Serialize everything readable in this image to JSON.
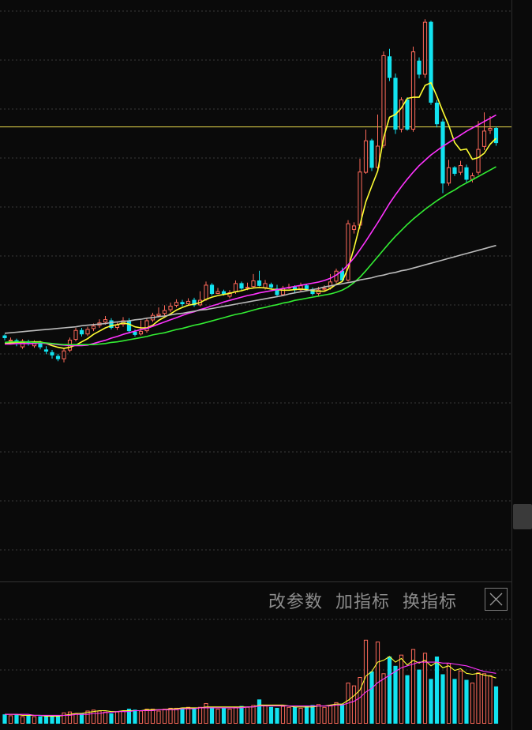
{
  "toolbar": {
    "modify_params": "改参数",
    "add_indicator": "加指标",
    "switch_indicator": "换指标"
  },
  "colors": {
    "background": "#0a0a0a",
    "up_candle": "#ff6a5a",
    "down_candle": "#12e3f0",
    "ma5": "#ffff33",
    "ma10": "#ff33ff",
    "ma20": "#33ee33",
    "ma60": "#bbbbbb",
    "reference_line": "#e6d94a",
    "grid": "#3a3a3a"
  },
  "icons": {
    "close": "close-x-icon"
  },
  "chart_data": [
    {
      "type": "candlestick",
      "name": "price",
      "ylim": [
        0,
        100
      ],
      "reference_level": 78.5,
      "candles": [
        [
          39.8,
          39.3,
          40.0,
          38.9
        ],
        [
          38.7,
          39.0,
          39.4,
          38.2
        ],
        [
          38.9,
          38.2,
          39.2,
          37.8
        ],
        [
          37.6,
          38.8,
          39.1,
          37.3
        ],
        [
          38.7,
          38.2,
          39.0,
          37.9
        ],
        [
          37.8,
          38.5,
          38.9,
          37.5
        ],
        [
          38.5,
          37.6,
          38.8,
          37.2
        ],
        [
          37.2,
          36.8,
          37.8,
          36.3
        ],
        [
          36.7,
          36.1,
          37.1,
          35.5
        ],
        [
          36.0,
          35.4,
          36.4,
          35.0
        ],
        [
          35.4,
          37.0,
          37.4,
          34.8
        ],
        [
          37.0,
          39.0,
          39.4,
          36.7
        ],
        [
          39.0,
          40.8,
          41.2,
          38.7
        ],
        [
          40.8,
          40.0,
          41.2,
          39.6
        ],
        [
          40.0,
          41.0,
          41.4,
          39.7
        ],
        [
          41.0,
          41.6,
          42.0,
          40.6
        ],
        [
          41.6,
          42.2,
          42.8,
          41.2
        ],
        [
          42.2,
          42.8,
          43.4,
          41.8
        ],
        [
          42.6,
          41.2,
          43.0,
          40.9
        ],
        [
          41.2,
          41.8,
          42.2,
          40.8
        ],
        [
          41.8,
          42.6,
          43.2,
          41.4
        ],
        [
          42.6,
          40.6,
          43.0,
          40.2
        ],
        [
          40.5,
          39.9,
          40.9,
          39.6
        ],
        [
          40.0,
          40.6,
          42.6,
          39.8
        ],
        [
          40.6,
          42.6,
          43.0,
          40.3
        ],
        [
          42.6,
          43.6,
          44.0,
          42.3
        ],
        [
          43.4,
          43.8,
          45.0,
          43.1
        ],
        [
          43.8,
          44.5,
          45.4,
          43.5
        ],
        [
          44.5,
          45.3,
          45.9,
          44.1
        ],
        [
          45.3,
          46.0,
          46.5,
          45.0
        ],
        [
          46.0,
          45.6,
          46.4,
          45.2
        ],
        [
          45.6,
          46.2,
          46.7,
          45.3
        ],
        [
          46.4,
          45.4,
          46.8,
          45.1
        ],
        [
          45.4,
          46.4,
          48.0,
          45.2
        ],
        [
          46.4,
          49.2,
          49.8,
          46.2
        ],
        [
          49.2,
          47.5,
          49.5,
          47.2
        ],
        [
          47.5,
          48.0,
          48.6,
          47.6
        ],
        [
          48.0,
          47.5,
          48.3,
          47.2
        ],
        [
          47.0,
          47.8,
          48.2,
          46.7
        ],
        [
          47.8,
          49.5,
          50.0,
          47.5
        ],
        [
          49.5,
          48.5,
          49.8,
          48.2
        ],
        [
          48.5,
          48.8,
          49.6,
          48.2
        ],
        [
          48.8,
          50.0,
          51.2,
          48.5
        ],
        [
          50.0,
          49.0,
          51.8,
          48.9
        ],
        [
          48.6,
          49.5,
          50.1,
          48.3
        ],
        [
          49.3,
          48.7,
          49.6,
          48.4
        ],
        [
          48.5,
          47.3,
          49.2,
          46.9
        ],
        [
          47.3,
          48.6,
          49.0,
          47.1
        ],
        [
          48.6,
          48.8,
          49.4,
          48.4
        ],
        [
          48.8,
          48.2,
          49.1,
          47.8
        ],
        [
          48.2,
          49.1,
          49.6,
          47.9
        ],
        [
          49.1,
          48.4,
          49.4,
          48.1
        ],
        [
          48.4,
          47.5,
          48.7,
          47.2
        ],
        [
          47.5,
          48.3,
          48.8,
          47.2
        ],
        [
          48.3,
          48.6,
          49.1,
          48.0
        ],
        [
          48.6,
          49.8,
          51.2,
          48.3
        ],
        [
          49.8,
          51.8,
          52.2,
          49.5
        ],
        [
          51.8,
          50.0,
          52.4,
          49.7
        ],
        [
          50.0,
          60.6,
          61.2,
          49.8
        ],
        [
          59.4,
          60.2,
          60.8,
          58.7
        ],
        [
          60.2,
          70.2,
          72.6,
          59.6
        ],
        [
          70.0,
          76.0,
          78.0,
          69.8
        ],
        [
          76.0,
          70.9,
          76.3,
          70.3
        ],
        [
          70.9,
          75.0,
          80.8,
          70.5
        ],
        [
          75.0,
          91.8,
          92.5,
          74.6
        ],
        [
          91.6,
          87.6,
          93.0,
          87.0
        ],
        [
          87.6,
          78.0,
          88.4,
          77.2
        ],
        [
          78.0,
          83.6,
          84.0,
          77.5
        ],
        [
          83.6,
          78.0,
          84.0,
          77.8
        ],
        [
          78.0,
          92.5,
          93.4,
          77.6
        ],
        [
          90.8,
          88.2,
          91.4,
          87.5
        ],
        [
          88.2,
          98.0,
          98.5,
          87.6
        ],
        [
          98.0,
          83.0,
          98.2,
          82.6
        ],
        [
          83.0,
          79.0,
          83.5,
          78.4
        ],
        [
          79.5,
          68.0,
          80.0,
          66.2
        ],
        [
          68.0,
          71.0,
          72.4,
          67.6
        ],
        [
          71.0,
          69.8,
          71.2,
          69.4
        ],
        [
          70.0,
          71.4,
          72.2,
          69.6
        ],
        [
          71.0,
          68.7,
          71.5,
          68.2
        ],
        [
          68.7,
          69.5,
          70.0,
          68.2
        ],
        [
          70.0,
          74.4,
          79.6,
          69.6
        ],
        [
          74.8,
          77.8,
          81.2,
          74.2
        ],
        [
          77.8,
          78.3,
          80.5,
          77.2
        ],
        [
          78.3,
          75.5,
          78.6,
          75.0
        ]
      ],
      "ma_lines": [
        {
          "period": 5,
          "values": [
            38.3,
            38.4,
            38.5,
            38.5,
            38.6,
            38.6,
            38.6,
            38.3,
            37.9,
            37.6,
            37.4,
            37.6,
            38.0,
            38.6,
            39.2,
            40.0,
            40.6,
            41.2,
            41.6,
            41.8,
            42.1,
            41.9,
            41.4,
            41.2,
            41.2,
            41.7,
            42.6,
            43.2,
            43.8,
            44.5,
            45.0,
            45.4,
            45.6,
            45.9,
            46.5,
            46.9,
            47.2,
            47.4,
            47.6,
            47.9,
            48.1,
            48.4,
            48.6,
            48.7,
            48.6,
            48.4,
            48.3,
            48.2,
            48.2,
            48.3,
            48.4,
            48.3,
            48.1,
            48.0,
            48.0,
            48.5,
            49.3,
            49.8,
            52.3,
            56.0,
            60.3,
            64.6,
            67.5,
            70.3,
            76.5,
            80.3,
            80.8,
            82.0,
            83.8,
            84.0,
            84.0,
            86.2,
            86.7,
            84.2,
            81.4,
            78.8,
            75.6,
            74.2,
            74.4,
            72.5,
            72.8,
            73.6,
            75.3,
            76.4
          ]
        },
        {
          "period": 10,
          "values": [
            38.2,
            38.2,
            38.3,
            38.3,
            38.3,
            38.3,
            38.4,
            38.3,
            38.2,
            38.1,
            38.0,
            37.9,
            37.9,
            37.9,
            38.0,
            38.3,
            38.6,
            38.9,
            39.3,
            39.6,
            40.0,
            40.3,
            40.6,
            40.9,
            41.1,
            41.5,
            41.9,
            42.3,
            42.7,
            43.1,
            43.5,
            43.9,
            44.2,
            44.6,
            44.9,
            45.3,
            45.6,
            46.0,
            46.3,
            46.6,
            46.9,
            47.2,
            47.4,
            47.7,
            47.9,
            48.1,
            48.3,
            48.5,
            48.7,
            48.9,
            49.1,
            49.3,
            49.5,
            49.7,
            50.0,
            50.4,
            51.0,
            51.8,
            52.9,
            54.2,
            55.7,
            57.3,
            59.0,
            60.7,
            62.5,
            64.3,
            65.9,
            67.4,
            68.8,
            70.1,
            71.3,
            72.3,
            73.3,
            74.1,
            74.9,
            75.6,
            76.3,
            77.0,
            77.7,
            78.3,
            78.9,
            79.5,
            80.1,
            80.7
          ]
        },
        {
          "period": 20,
          "values": [
            38.5,
            38.6,
            38.6,
            38.6,
            38.6,
            38.5,
            38.5,
            38.4,
            38.3,
            38.2,
            38.1,
            38.1,
            38.1,
            38.1,
            38.1,
            38.1,
            38.2,
            38.3,
            38.5,
            38.6,
            38.8,
            39.0,
            39.2,
            39.4,
            39.6,
            39.9,
            40.1,
            40.3,
            40.6,
            40.9,
            41.1,
            41.4,
            41.7,
            41.9,
            42.2,
            42.5,
            42.8,
            43.1,
            43.4,
            43.7,
            43.9,
            44.2,
            44.5,
            44.8,
            45.0,
            45.3,
            45.5,
            45.8,
            46.0,
            46.3,
            46.5,
            46.7,
            46.9,
            47.1,
            47.3,
            47.5,
            47.8,
            48.2,
            48.8,
            49.6,
            50.6,
            51.8,
            53.1,
            54.4,
            55.7,
            57.0,
            58.2,
            59.3,
            60.4,
            61.4,
            62.3,
            63.2,
            64.0,
            64.8,
            65.5,
            66.2,
            66.8,
            67.5,
            68.1,
            68.7,
            69.3,
            69.9,
            70.5,
            71.1
          ]
        },
        {
          "period": 60,
          "values": [
            40.2,
            40.3,
            40.4,
            40.5,
            40.6,
            40.7,
            40.8,
            40.9,
            41.0,
            41.1,
            41.2,
            41.3,
            41.4,
            41.6,
            41.7,
            41.8,
            41.9,
            42.0,
            42.2,
            42.3,
            42.4,
            42.5,
            42.7,
            42.8,
            43.0,
            43.1,
            43.3,
            43.4,
            43.6,
            43.8,
            43.9,
            44.1,
            44.3,
            44.5,
            44.6,
            44.8,
            45.0,
            45.2,
            45.4,
            45.6,
            45.8,
            46.0,
            46.2,
            46.4,
            46.6,
            46.8,
            47.0,
            47.2,
            47.5,
            47.7,
            47.9,
            48.1,
            48.3,
            48.5,
            48.8,
            49.0,
            49.2,
            49.4,
            49.6,
            49.8,
            50.1,
            50.3,
            50.5,
            50.8,
            51.0,
            51.3,
            51.5,
            51.8,
            52.0,
            52.3,
            52.6,
            52.9,
            53.2,
            53.5,
            53.8,
            54.1,
            54.4,
            54.7,
            55.0,
            55.3,
            55.6,
            55.9,
            56.2,
            56.5
          ]
        }
      ]
    },
    {
      "type": "bar",
      "name": "volume",
      "ylim": [
        0,
        100
      ],
      "values": [
        10,
        9,
        10,
        8,
        9,
        8,
        8,
        9,
        8,
        9,
        12,
        13,
        11,
        11,
        14,
        15,
        14,
        13,
        11,
        13,
        14,
        16,
        15,
        14,
        16,
        16,
        14,
        16,
        17,
        17,
        17,
        18,
        17,
        18,
        22,
        18,
        16,
        17,
        16,
        18,
        19,
        18,
        20,
        26,
        20,
        18,
        17,
        19,
        18,
        18,
        17,
        19,
        20,
        21,
        18,
        20,
        23,
        21,
        44,
        41,
        50,
        90,
        56,
        88,
        54,
        72,
        62,
        74,
        52,
        80,
        58,
        76,
        48,
        72,
        53,
        65,
        48,
        57,
        47,
        44,
        55,
        54,
        52,
        40
      ],
      "ma_lines": [
        {
          "period": 5,
          "values": [
            10,
            10,
            10,
            9,
            9,
            9,
            9,
            8,
            8,
            8,
            9,
            10,
            11,
            11,
            12,
            13,
            14,
            14,
            13,
            13,
            14,
            14,
            14,
            14,
            15,
            15,
            15,
            15,
            16,
            16,
            17,
            17,
            17,
            17,
            18,
            18,
            18,
            18,
            18,
            18,
            18,
            18,
            18,
            20,
            20,
            20,
            20,
            20,
            19,
            18,
            18,
            18,
            18,
            19,
            19,
            20,
            21,
            21,
            25,
            30,
            36,
            51,
            56,
            66,
            68,
            72,
            66,
            70,
            63,
            68,
            65,
            68,
            62,
            66,
            60,
            62,
            57,
            59,
            54,
            53,
            54,
            52,
            51,
            49
          ]
        },
        {
          "period": 10,
          "values": [
            10,
            10,
            10,
            10,
            10,
            9,
            9,
            9,
            9,
            9,
            9,
            9,
            10,
            10,
            10,
            11,
            11,
            12,
            12,
            13,
            13,
            13,
            14,
            14,
            14,
            14,
            15,
            15,
            15,
            15,
            16,
            16,
            16,
            17,
            17,
            17,
            17,
            17,
            17,
            17,
            17,
            18,
            18,
            19,
            19,
            19,
            19,
            19,
            19,
            19,
            19,
            19,
            19,
            19,
            19,
            19,
            20,
            20,
            22,
            24,
            28,
            34,
            38,
            44,
            48,
            52,
            56,
            60,
            62,
            64,
            66,
            66,
            66,
            66,
            65,
            65,
            64,
            63,
            62,
            60,
            58,
            56,
            55,
            54
          ]
        }
      ]
    }
  ]
}
